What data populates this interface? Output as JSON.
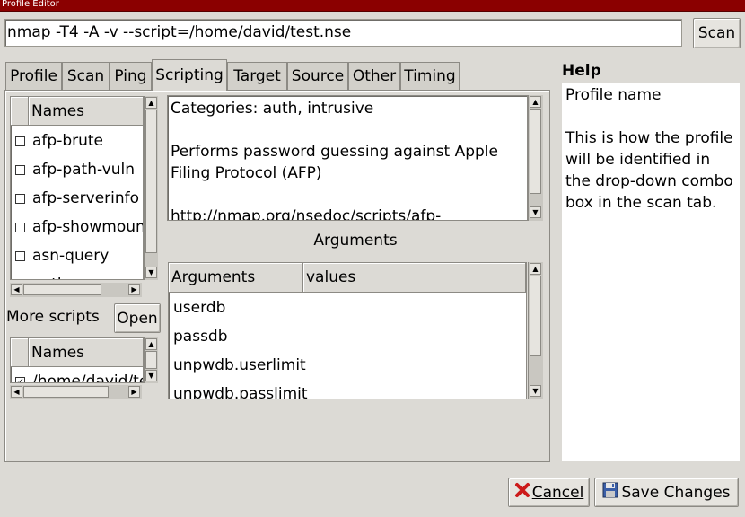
{
  "window": {
    "title": "Profile Editor"
  },
  "command": {
    "value": "nmap -T4 -A -v --script=/home/david/test.nse"
  },
  "scan_button": "Scan",
  "tabs": [
    {
      "label": "Profile",
      "active": false
    },
    {
      "label": "Scan",
      "active": false
    },
    {
      "label": "Ping",
      "active": false
    },
    {
      "label": "Scripting",
      "active": true
    },
    {
      "label": "Target",
      "active": false
    },
    {
      "label": "Source",
      "active": false
    },
    {
      "label": "Other",
      "active": false
    },
    {
      "label": "Timing",
      "active": false
    }
  ],
  "scripts_list": {
    "header": "Names",
    "items": [
      {
        "label": "afp-brute",
        "checked": false
      },
      {
        "label": "afp-path-vuln",
        "checked": false
      },
      {
        "label": "afp-serverinfo",
        "checked": false
      },
      {
        "label": "afp-showmount",
        "checked": false
      },
      {
        "label": "asn-query",
        "checked": false
      },
      {
        "label": "auth-owners",
        "checked": false
      }
    ]
  },
  "more_scripts": {
    "label": "More scripts",
    "open_button": "Open",
    "header": "Names",
    "items": [
      {
        "label": "/home/david/test.nse",
        "checked": true
      }
    ]
  },
  "description": {
    "lines": [
      "Categories: auth, intrusive",
      "",
      "Performs password guessing against Apple",
      "Filing Protocol (AFP)",
      "",
      "http://nmap.org/nsedoc/scripts/afp-"
    ]
  },
  "arguments": {
    "title": "Arguments",
    "col_arguments": "Arguments",
    "col_values": "values",
    "rows": [
      {
        "name": "userdb",
        "value": ""
      },
      {
        "name": "passdb",
        "value": ""
      },
      {
        "name": "unpwdb.userlimit",
        "value": ""
      },
      {
        "name": "unpwdb.passlimit",
        "value": ""
      }
    ]
  },
  "help": {
    "title": "Help",
    "heading": "Profile name",
    "body": "This is how the profile will be identified in the drop-down combo box in the scan tab."
  },
  "buttons": {
    "cancel": "Cancel",
    "save": "Save Changes"
  },
  "colors": {
    "titlebar": "#8b0000",
    "window_bg": "#dcdad5"
  },
  "icons": {
    "cancel": "red-x-icon",
    "save": "floppy-disk-icon"
  }
}
